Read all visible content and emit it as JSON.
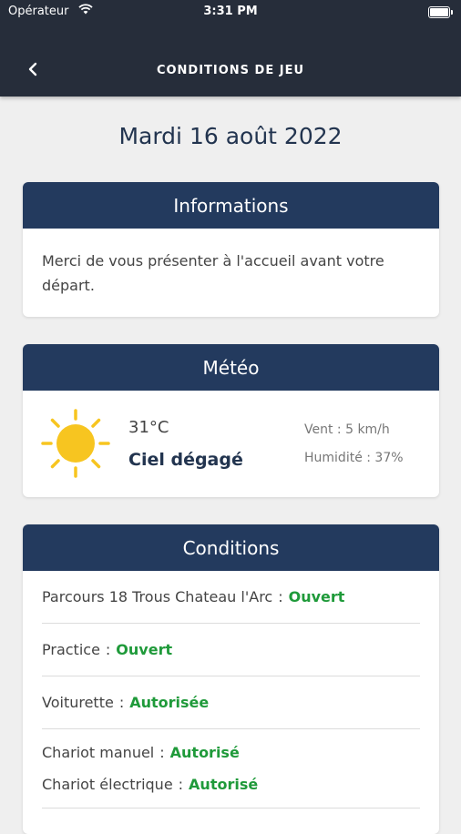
{
  "status_bar": {
    "carrier": "Opérateur",
    "time": "3:31 PM"
  },
  "header": {
    "title": "CONDITIONS DE JEU"
  },
  "date": "Mardi 16 août 2022",
  "information": {
    "title": "Informations",
    "text": "Merci de vous présenter à l'accueil avant votre départ."
  },
  "meteo": {
    "title": "Météo",
    "temperature": "31°C",
    "sky": "Ciel dégagé",
    "wind": "Vent : 5 km/h",
    "humidity": "Humidité : 37%",
    "icon": "sun-icon"
  },
  "conditions": {
    "title": "Conditions",
    "items": [
      {
        "label": "Parcours 18 Trous Chateau l'Arc",
        "status": "Ouvert"
      },
      {
        "label": "Practice",
        "status": "Ouvert"
      },
      {
        "label": "Voiturette",
        "status": "Autorisée"
      },
      {
        "label": "Chariot manuel",
        "status": "Autorisé"
      },
      {
        "label": "Chariot électrique",
        "status": "Autorisé"
      }
    ]
  },
  "colors": {
    "header_bg": "#262d3a",
    "card_header_bg": "#233a5e",
    "status_green": "#1f9a3a",
    "sun": "#f7c520"
  }
}
